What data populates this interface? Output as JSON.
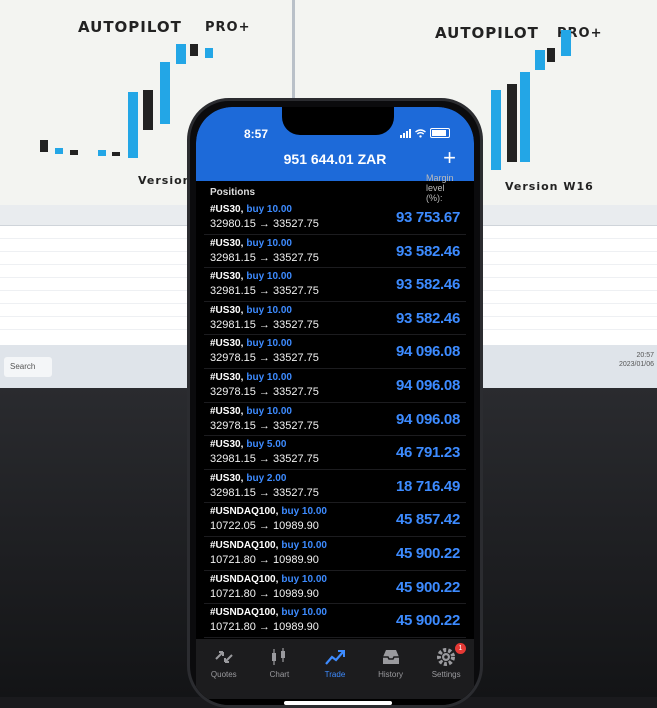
{
  "background": {
    "left_brand": "AUTOPILOT",
    "left_brand_suffix": "PRO+",
    "left_version": "Version W",
    "right_brand": "AUTOPILOT",
    "right_brand_suffix": "PRO+",
    "right_version": "Version W16",
    "search_label": "Search",
    "tray_clock_time": "20:57",
    "tray_clock_date": "2023/01/06"
  },
  "phone": {
    "status_time": "8:57",
    "balance": "951 644.01 ZAR",
    "margin_level_clip": "Margin level (%):",
    "positions_heading": "Positions",
    "positions": [
      {
        "symbol": "#US30,",
        "direction": "buy 10.00",
        "prices": "32980.15 → 33527.75",
        "profit": "93 753.67"
      },
      {
        "symbol": "#US30,",
        "direction": "buy 10.00",
        "prices": "32981.15 → 33527.75",
        "profit": "93 582.46"
      },
      {
        "symbol": "#US30,",
        "direction": "buy 10.00",
        "prices": "32981.15 → 33527.75",
        "profit": "93 582.46"
      },
      {
        "symbol": "#US30,",
        "direction": "buy 10.00",
        "prices": "32981.15 → 33527.75",
        "profit": "93 582.46"
      },
      {
        "symbol": "#US30,",
        "direction": "buy 10.00",
        "prices": "32978.15 → 33527.75",
        "profit": "94 096.08"
      },
      {
        "symbol": "#US30,",
        "direction": "buy 10.00",
        "prices": "32978.15 → 33527.75",
        "profit": "94 096.08"
      },
      {
        "symbol": "#US30,",
        "direction": "buy 10.00",
        "prices": "32978.15 → 33527.75",
        "profit": "94 096.08"
      },
      {
        "symbol": "#US30,",
        "direction": "buy 5.00",
        "prices": "32981.15 → 33527.75",
        "profit": "46 791.23"
      },
      {
        "symbol": "#US30,",
        "direction": "buy 2.00",
        "prices": "32981.15 → 33527.75",
        "profit": "18 716.49"
      },
      {
        "symbol": "#USNDAQ100,",
        "direction": "buy 10.00",
        "prices": "10722.05 → 10989.90",
        "profit": "45 857.42"
      },
      {
        "symbol": "#USNDAQ100,",
        "direction": "buy 10.00",
        "prices": "10721.80 → 10989.90",
        "profit": "45 900.22"
      },
      {
        "symbol": "#USNDAQ100,",
        "direction": "buy 10.00",
        "prices": "10721.80 → 10989.90",
        "profit": "45 900.22"
      },
      {
        "symbol": "#USNDAQ100,",
        "direction": "buy 10.00",
        "prices": "10721.80 → 10989.90",
        "profit": "45 900.22"
      },
      {
        "symbol": "#USNDAQ100,",
        "direction": "buy 10.00",
        "prices": "10721.80 → 10989.90",
        "profit": "45 900.22"
      }
    ],
    "tabs": [
      {
        "label": "Quotes",
        "icon": "quotes-icon"
      },
      {
        "label": "Chart",
        "icon": "chart-icon"
      },
      {
        "label": "Trade",
        "icon": "trade-icon"
      },
      {
        "label": "History",
        "icon": "history-icon"
      },
      {
        "label": "Settings",
        "icon": "settings-icon"
      }
    ],
    "settings_badge": "1",
    "colors": {
      "header_blue": "#1d6ad9",
      "accent_blue": "#3d8bff",
      "screen_bg": "#000000"
    }
  }
}
